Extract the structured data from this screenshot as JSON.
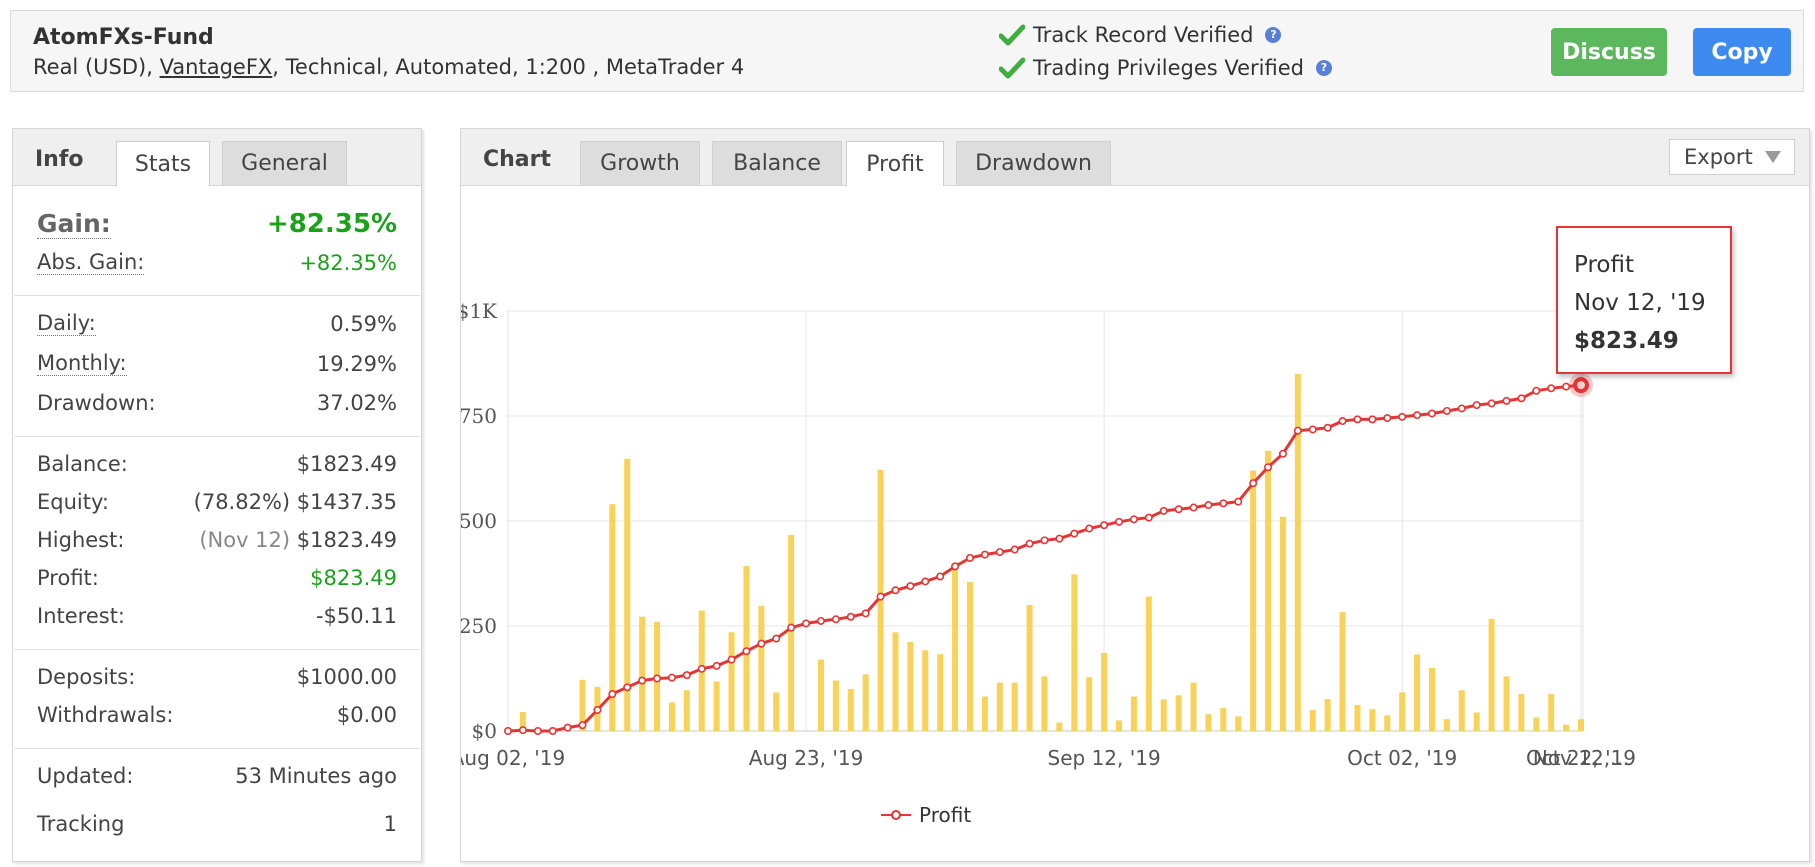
{
  "header": {
    "title": "AtomFXs-Fund",
    "sub_prefix": "Real (USD), ",
    "broker": "VantageFX",
    "sub_suffix": ", Technical, Automated, 1:200 , MetaTrader 4",
    "verify1": "Track Record Verified",
    "verify2": "Trading Privileges Verified",
    "help_glyph": "?",
    "discuss_label": "Discuss",
    "copy_label": "Copy"
  },
  "info": {
    "tab_title": "Info",
    "tabs": [
      "Stats",
      "General"
    ],
    "gain_label": "Gain:",
    "gain_value": "+82.35%",
    "abs_gain_label": "Abs. Gain:",
    "abs_gain_value": "+82.35%",
    "daily_label": "Daily:",
    "daily_value": "0.59%",
    "monthly_label": "Monthly:",
    "monthly_value": "19.29%",
    "drawdown_label": "Drawdown:",
    "drawdown_value": "37.02%",
    "balance_label": "Balance:",
    "balance_value": "$1823.49",
    "equity_label": "Equity:",
    "equity_pct": "(78.82%)",
    "equity_value": "$1437.35",
    "highest_label": "Highest:",
    "highest_date": "(Nov 12)",
    "highest_value": "$1823.49",
    "profit_label": "Profit:",
    "profit_value": "$823.49",
    "interest_label": "Interest:",
    "interest_value": "-$50.11",
    "deposits_label": "Deposits:",
    "deposits_value": "$1000.00",
    "withdrawals_label": "Withdrawals:",
    "withdrawals_value": "$0.00",
    "updated_label": "Updated:",
    "updated_value": "53 Minutes ago",
    "tracking_label": "Tracking",
    "tracking_value": "1"
  },
  "chart_panel": {
    "tab_title": "Chart",
    "tabs": [
      "Growth",
      "Balance",
      "Profit",
      "Drawdown"
    ],
    "active_tab": "Profit",
    "export_label": "Export",
    "tooltip": {
      "title": "Profit",
      "date": "Nov 12, '19",
      "value": "$823.49"
    }
  },
  "colors": {
    "bar": "#f9d259",
    "line": "#e53535",
    "green": "#1aa31a",
    "discuss": "#5cb85c",
    "copy": "#3d8bf0"
  },
  "chart_data": {
    "type": "bar",
    "ylim": [
      0,
      1000
    ],
    "y_ticks": [
      0,
      250,
      500,
      750,
      1000
    ],
    "y_tick_labels": [
      "$0",
      "$250",
      "$500",
      "$750",
      "$1K"
    ],
    "x_tick_labels": [
      "Aug 02, '19",
      "Aug 23, '19",
      "Sep 12, '19",
      "Oct 02, '19",
      "Oct 22, '19",
      "Nov 12,..."
    ],
    "x_tick_indices": [
      0,
      20,
      40,
      60,
      80,
      100
    ],
    "legend": "Profit",
    "legend_position": "bottom-center",
    "grid": true,
    "bars": [
      0,
      45,
      0,
      0,
      0,
      122,
      105,
      540,
      648,
      272,
      260,
      68,
      97,
      287,
      118,
      235,
      393,
      298,
      92,
      467,
      0,
      170,
      120,
      100,
      135,
      622,
      235,
      212,
      192,
      183,
      385,
      355,
      82,
      115,
      115,
      300,
      130,
      20,
      373,
      128,
      186,
      25,
      82,
      320,
      75,
      85,
      115,
      40,
      55,
      35,
      620,
      667,
      510,
      850,
      50,
      76,
      283,
      62,
      52,
      37,
      92,
      182,
      150,
      28,
      97,
      44,
      267,
      130,
      88,
      32,
      88,
      15,
      28
    ],
    "series": [
      {
        "name": "Profit",
        "type": "line",
        "values": [
          0,
          2,
          0,
          0,
          8,
          14,
          50,
          88,
          104,
          120,
          125,
          127,
          133,
          148,
          155,
          170,
          190,
          208,
          220,
          246,
          256,
          262,
          266,
          272,
          280,
          320,
          335,
          345,
          356,
          368,
          392,
          412,
          420,
          426,
          432,
          446,
          454,
          458,
          470,
          482,
          490,
          498,
          504,
          508,
          524,
          528,
          532,
          538,
          542,
          546,
          590,
          628,
          660,
          715,
          718,
          722,
          738,
          742,
          742,
          745,
          748,
          752,
          756,
          762,
          768,
          776,
          780,
          786,
          792,
          810,
          816,
          820,
          823.49
        ]
      }
    ]
  }
}
